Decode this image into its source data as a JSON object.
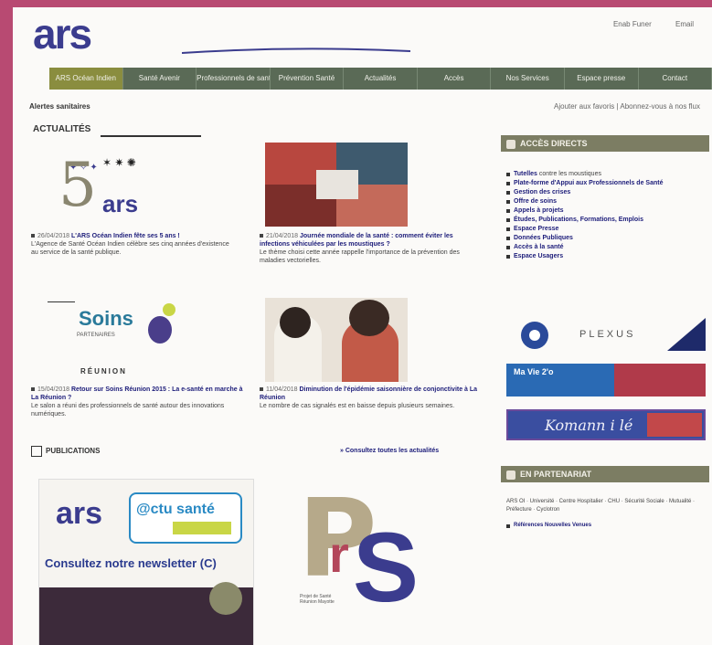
{
  "header": {
    "logo_text": "ars",
    "top_links": [
      "Enab Funer",
      "Email"
    ]
  },
  "nav": {
    "items": [
      "ARS Océan Indien",
      "Santé Avenir",
      "Professionnels de santé",
      "Prévention Santé",
      "Actualités",
      "Accès",
      "Nos Services",
      "Espace presse",
      "Contact"
    ]
  },
  "subbar": {
    "left": "Alertes sanitaires",
    "right": "Ajouter aux favoris | Abonnez-vous à nos flux"
  },
  "actualites": {
    "title": "ACTUALITÉS",
    "items": [
      {
        "date": "26/04/2018",
        "headline": "L'ARS Océan Indien fête ses 5 ans !",
        "summary": "L'Agence de Santé Océan Indien célèbre ses cinq années d'existence au service de la santé publique."
      },
      {
        "date": "21/04/2018",
        "headline": "Journée mondiale de la santé : comment éviter les infections véhiculées par les moustiques ?",
        "summary": "Le thème choisi cette année rappelle l'importance de la prévention des maladies vectorielles."
      },
      {
        "date": "15/04/2018",
        "headline": "Retour sur Soins Réunion 2015 : La e-santé en marche à La Réunion ?",
        "summary": "Le salon a réuni des professionnels de santé autour des innovations numériques."
      },
      {
        "date": "11/04/2018",
        "headline": "Diminution de l'épidémie saisonnière de conjonctivite à La Réunion",
        "summary": "Le nombre de cas signalés est en baisse depuis plusieurs semaines."
      }
    ],
    "logo_5_number": "5",
    "logo_5_text": "ars",
    "soins_title": "Soins",
    "soins_sub": "PARTENAIRES",
    "soins_footer": "RÉUNION"
  },
  "publications": {
    "title": "PUBLICATIONS",
    "all_link": "» Consultez toutes les actualités",
    "newsletter_logo": "ars",
    "newsletter_badge": "@ctu santé",
    "newsletter_text": "Consultez notre newsletter (C)",
    "prs_p": "P",
    "prs_r": "r",
    "prs_s": "S",
    "prs_sub": "Projet de Santé Réunion Mayotte"
  },
  "sidebar": {
    "box1_title": "ACCÈS DIRECTS",
    "links": [
      {
        "bold": "Tutelles",
        "rest": " contre les moustiques"
      },
      {
        "bold": "Plate-forme d'Appui aux Professionnels de Santé",
        "rest": ""
      },
      {
        "bold": "Gestion des crises",
        "rest": ""
      },
      {
        "bold": "Offre de soins",
        "rest": ""
      },
      {
        "bold": "Appels à projets",
        "rest": ""
      },
      {
        "bold": "Études, Publications, Formations, Emplois",
        "rest": ""
      },
      {
        "bold": "Espace Presse",
        "rest": ""
      },
      {
        "bold": "Données Publiques",
        "rest": ""
      },
      {
        "bold": "Accès à la santé",
        "rest": ""
      },
      {
        "bold": "Espace Usagers",
        "rest": ""
      }
    ],
    "plexus_text": "PLEXUS",
    "banner2_text": "Ma Vie 2'o",
    "banner3_text": "Komann i lé",
    "box2_title": "EN PARTENARIAT",
    "partners": "ARS OI · Université · Centre Hospitalier · CHU · Sécurité Sociale · Mutualité · Préfecture · Cyclotron",
    "partners_link": "Références Nouvelles Venues"
  }
}
